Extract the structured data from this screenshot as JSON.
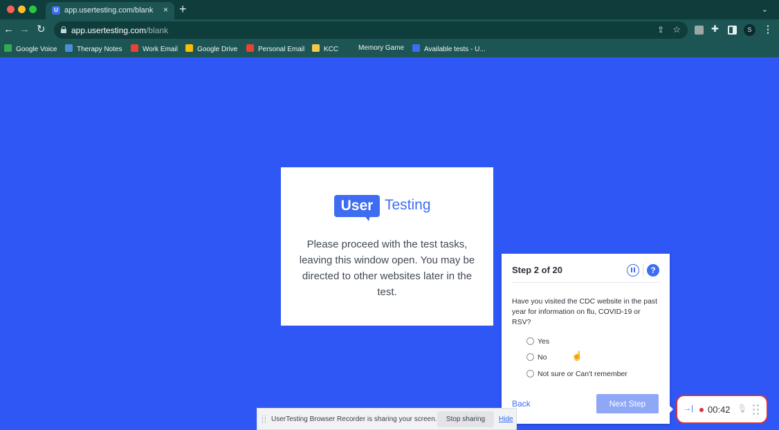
{
  "browser": {
    "tab": {
      "title": "app.usertesting.com/blank",
      "close_glyph": "×"
    },
    "new_tab_glyph": "+",
    "tab_menu_glyph": "⌄",
    "nav": {
      "back": "←",
      "forward": "→",
      "reload": "↻"
    },
    "url": {
      "host": "app.usertesting.com",
      "path": "/blank"
    },
    "profile_initial": "S",
    "bookmarks": [
      {
        "label": "Google Voice",
        "icon": "google-voice-icon",
        "color": "#34a853"
      },
      {
        "label": "Therapy Notes",
        "icon": "therapy-notes-icon",
        "color": "#4a8fd6"
      },
      {
        "label": "Work Email",
        "icon": "gmail-icon",
        "color": "#ea4335"
      },
      {
        "label": "Google Drive",
        "icon": "google-drive-icon",
        "color": "#fbbc04"
      },
      {
        "label": "Personal Email",
        "icon": "gmail-icon",
        "color": "#ea4335"
      },
      {
        "label": "KCC",
        "icon": "kcc-icon",
        "color": "#f2c94c"
      },
      {
        "label": "Memory Game",
        "icon": "",
        "color": ""
      },
      {
        "label": "Available tests - U...",
        "icon": "usertesting-icon",
        "color": "#3e6df2"
      }
    ]
  },
  "card": {
    "logo": {
      "user": "User",
      "testing": "Testing"
    },
    "message": "Please proceed with the test tasks, leaving this window open. You may be directed to other websites later in the test."
  },
  "step": {
    "title": "Step 2 of 20",
    "help_glyph": "?",
    "question": "Have you visited the CDC website in the past year for information on flu, COVID-19 or RSV?",
    "options": [
      "Yes",
      "No",
      "Not sure or Can't remember"
    ],
    "back_label": "Back",
    "next_label": "Next Step"
  },
  "recorder": {
    "collapse_glyph": "→|",
    "time": "00:42",
    "mic_glyph": "🎙"
  },
  "sharebar": {
    "message": "UserTesting Browser Recorder is sharing your screen.",
    "stop_label": "Stop sharing",
    "hide_label": "Hide"
  },
  "colors": {
    "page_background": "#2f57f5",
    "brand_blue": "#3e6df2",
    "recording_red": "#d83339",
    "chrome_dark": "#0f3d3c",
    "chrome_mid": "#1d5554"
  }
}
